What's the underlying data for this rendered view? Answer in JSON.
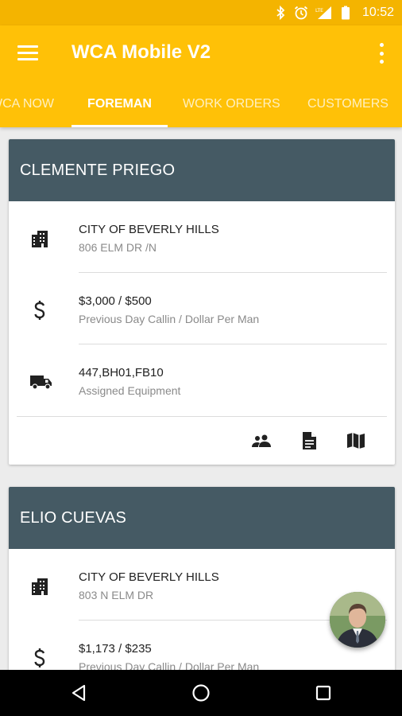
{
  "status_bar": {
    "time": "10:52",
    "icons": [
      "bluetooth-icon",
      "alarm-icon",
      "signal-lte-icon",
      "battery-icon"
    ],
    "lte_label": "LTE"
  },
  "app_bar": {
    "title": "WCA Mobile V2",
    "color": "#ffc107",
    "status_color": "#f4b400"
  },
  "tabs": [
    {
      "label": "WCA NOW",
      "active": false
    },
    {
      "label": "FOREMAN",
      "active": true
    },
    {
      "label": "WORK ORDERS",
      "active": false
    },
    {
      "label": "CUSTOMERS",
      "active": false
    }
  ],
  "cards": [
    {
      "name": "CLEMENTE PRIEGO",
      "header_color": "#455a64",
      "location": {
        "title": "CITY OF BEVERLY HILLS",
        "subtitle": "806 ELM DR /N",
        "icon": "building-icon"
      },
      "callin": {
        "title": "$3,000 / $500",
        "subtitle": "Previous Day Callin / Dollar Per Man",
        "icon": "dollar-icon"
      },
      "equipment": {
        "title": "447,BH01,FB10",
        "subtitle": "Assigned Equipment",
        "icon": "truck-icon"
      },
      "actions": [
        "crew-icon",
        "document-icon",
        "map-icon"
      ]
    },
    {
      "name": "ELIO CUEVAS",
      "header_color": "#455a64",
      "location": {
        "title": "CITY OF BEVERLY HILLS",
        "subtitle": "803 N ELM DR",
        "icon": "building-icon"
      },
      "callin": {
        "title": "$1,173 / $235",
        "subtitle": "Previous Day Callin / Dollar Per Man",
        "icon": "dollar-icon"
      }
    }
  ],
  "nav_bar": {
    "buttons": [
      "back-icon",
      "home-icon",
      "recents-icon"
    ]
  }
}
